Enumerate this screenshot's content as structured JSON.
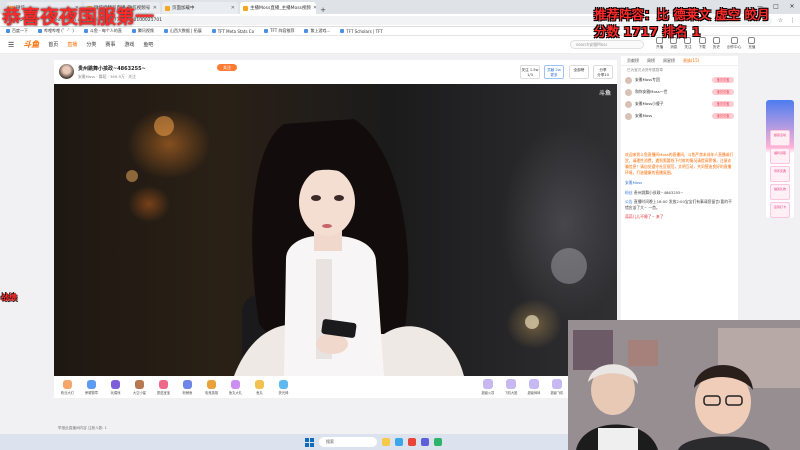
{
  "browser": {
    "tabs": [
      {
        "label": "微信",
        "active": false
      },
      {
        "label": "微信视频号直播_微信视频号",
        "active": false
      },
      {
        "label": "页面加载中",
        "active": false
      },
      {
        "label": "主播Moss直播_主播Moss视频",
        "active": true
      }
    ],
    "new_tab": "+",
    "url": "video.weixin.qq.com/live/n4b72b0c4b0100021701",
    "bookmarks": [
      "百度一下",
      "哔哩哔哩 (゜-゜)",
      "斗鱼 - 每个人的直",
      "腾讯视频",
      "山西大数据 | 拓展",
      "TFT Meta Stats Co",
      "TFT 阵容推荐",
      "紫上游戏...",
      "TFT Scholars | TFT"
    ],
    "window_controls": [
      "—",
      "□",
      "✕"
    ]
  },
  "site": {
    "logo": "斗鱼",
    "nav": [
      "首页",
      "直播",
      "分类",
      "赛事",
      "游戏",
      "鱼吧"
    ],
    "active_nav": "直播",
    "search_placeholder": "search安雅Moss",
    "header_icons": [
      "开播",
      "消息",
      "关注",
      "下载",
      "历史",
      "创作中心",
      "充值"
    ]
  },
  "stream": {
    "room_title": "贵州跳舞小孩政~4863255~",
    "follow_label": "关注",
    "room_meta": "安雅Moss  · 舞蹈 · 369.9万 · 关注",
    "stats": [
      {
        "top": "关注 1.5w",
        "bottom": "1/3"
      },
      {
        "top": "贡献 2w",
        "bottom": "更多"
      },
      {
        "top": "全部榜",
        "bottom": ""
      },
      {
        "top": "分享",
        "bottom": "分享10"
      }
    ],
    "watermark": "斗鱼"
  },
  "gifts_left": [
    {
      "label": "粉丝大灯",
      "color": "#f4a66b"
    },
    {
      "label": "荣耀徽章",
      "color": "#5b9cf2"
    },
    {
      "label": "玩偶熊",
      "color": "#7e5fd9"
    },
    {
      "label": "大空小星",
      "color": "#b77952"
    },
    {
      "label": "蘑菇宝宝",
      "color": "#ef6a8a"
    },
    {
      "label": "粉鲸鱼",
      "color": "#6f86e8"
    },
    {
      "label": "电竞英雄",
      "color": "#e9a23b"
    },
    {
      "label": "鱼丸大礼",
      "color": "#cc8ef0"
    },
    {
      "label": "鱼丸",
      "color": "#f2c14e"
    },
    {
      "label": "荧光棒",
      "color": "#5fb8ef"
    }
  ],
  "gifts_right": [
    "超级火箭",
    "飞机大团",
    "超级棒棒",
    "超级飞机",
    "超级嘉年",
    "私人定制"
  ],
  "status_line": "举报此直播间内容  注册人数: 1",
  "chat": {
    "tabs": [
      "贡献榜",
      "周榜",
      "周星榜",
      "贵族(15)"
    ],
    "active_tab": "贵族(15)",
    "rank_note": "已为宝贝点亮专属勋章",
    "fans": [
      {
        "name": "安雅Moss专团",
        "badge": "宝贝贝宝"
      },
      {
        "name": "和你安雅Moss一世",
        "badge": "宝贝贝宝"
      },
      {
        "name": "安雅Moss小傻子",
        "badge": "宝贝贝宝"
      },
      {
        "name": "安雅Moss",
        "badge": "宝贝贝宝"
      }
    ],
    "notice": "欢迎来到斗鱼直播间Moss的直播间，斗鱼严禁未成年人直播或打赏，请理性消费，遇到需要线下付款的情况请提高警惕，注意诈骗信息！请自觉遵守社区规范，文明互动，共同营造良好的直播环境，打造健康的直播氛围。",
    "messages": [
      {
        "user": "安雅Moss",
        "text": "",
        "style": "normal"
      },
      {
        "user": "粉丝",
        "text": "贵州跳舞小孩政~4863255~",
        "style": "normal"
      },
      {
        "user": "公告",
        "text": "直播时间晚上18:00 发放2:00宝宝们有事请您留言!要的不错应该了大~  一首。",
        "style": "normal"
      },
      {
        "user": "",
        "text": "蒜蒜儿儿不睡了~  来了",
        "style": "red"
      }
    ]
  },
  "ad": [
    "超级活动",
    "福利领取",
    "周年庆典",
    "抽奖礼物",
    "签到打卡"
  ],
  "taskbar": {
    "search": "搜索",
    "tray": "英 19:45"
  },
  "overlay": {
    "title": "恭喜夜夜国服第一",
    "recommend": "推荐阵容：比 德莱文 虚空 皎月",
    "score": "分数 1717 排名 1",
    "side": "战绩"
  }
}
